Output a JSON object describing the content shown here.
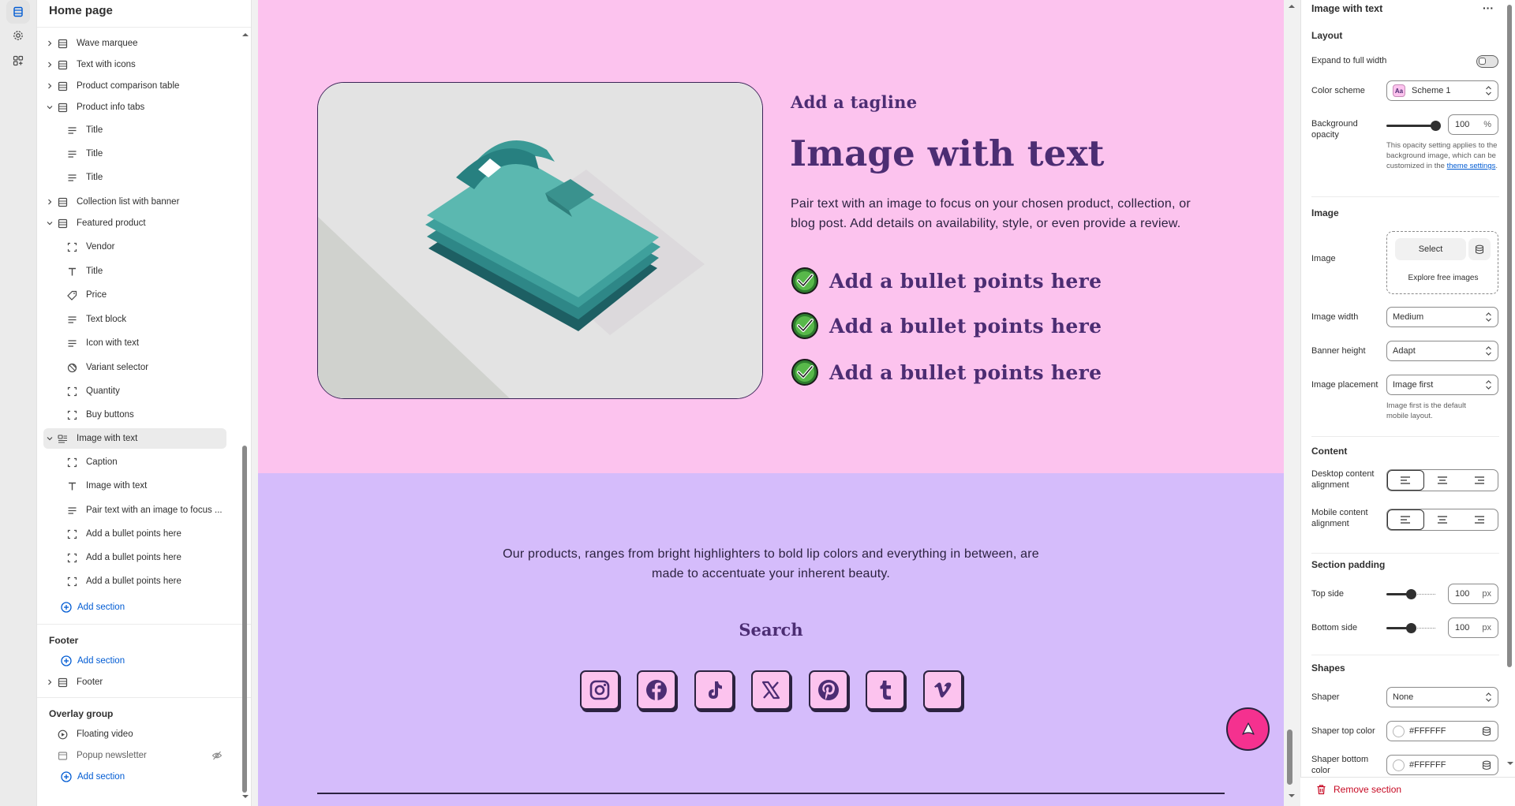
{
  "sidebar": {
    "title": "Home page",
    "items": [
      {
        "label": "Wave marquee",
        "icon": "section-icon",
        "expanded": false
      },
      {
        "label": "Text with icons",
        "icon": "section-icon",
        "expanded": false
      },
      {
        "label": "Product comparison table",
        "icon": "section-icon",
        "expanded": false
      },
      {
        "label": "Product info tabs",
        "icon": "section-icon",
        "expanded": true
      },
      {
        "label": "Title",
        "icon": "text-block-icon"
      },
      {
        "label": "Title",
        "icon": "text-block-icon"
      },
      {
        "label": "Title",
        "icon": "text-block-icon"
      },
      {
        "label": "Collection list with banner",
        "icon": "section-icon",
        "expanded": false
      },
      {
        "label": "Featured product",
        "icon": "section-icon",
        "expanded": true
      },
      {
        "label": "Vendor",
        "icon": "block-icon"
      },
      {
        "label": "Title",
        "icon": "title-icon"
      },
      {
        "label": "Price",
        "icon": "price-icon"
      },
      {
        "label": "Text block",
        "icon": "text-block-icon"
      },
      {
        "label": "Icon with text",
        "icon": "text-block-icon"
      },
      {
        "label": "Variant selector",
        "icon": "variant-icon"
      },
      {
        "label": "Quantity",
        "icon": "block-icon"
      },
      {
        "label": "Buy buttons",
        "icon": "block-icon"
      },
      {
        "label": "Image with text",
        "icon": "image-text-icon",
        "expanded": true,
        "selected": true
      },
      {
        "label": "Caption",
        "icon": "block-icon"
      },
      {
        "label": "Image with text",
        "icon": "title-icon"
      },
      {
        "label": "Pair text with an image to focus ...",
        "icon": "text-block-icon"
      },
      {
        "label": "Add a bullet points here",
        "icon": "block-icon"
      },
      {
        "label": "Add a bullet points here",
        "icon": "block-icon"
      },
      {
        "label": "Add a bullet points here",
        "icon": "block-icon"
      }
    ],
    "add_section": "Add section",
    "footer_group": {
      "title": "Footer",
      "add_section": "Add section",
      "items": [
        {
          "label": "Footer"
        }
      ]
    },
    "overlay_group": {
      "title": "Overlay group",
      "items": [
        {
          "label": "Floating video"
        },
        {
          "label": "Popup newsletter"
        }
      ],
      "add_section": "Add section"
    }
  },
  "preview": {
    "tagline": "Add a tagline",
    "title": "Image with text",
    "body": "Pair text with an image to focus on your chosen product, collection, or blog post. Add details on availability, style, or even provide a review.",
    "bullets": [
      "Add a bullet points here",
      "Add a bullet points here",
      "Add a bullet points here"
    ],
    "lavender_text": "Our products, ranges from bright highlighters to bold lip colors and everything in between, are made to accentuate your inherent beauty.",
    "search_label": "Search",
    "socials": [
      "instagram-icon",
      "facebook-icon",
      "tiktok-icon",
      "x-icon",
      "pinterest-icon",
      "tumblr-icon",
      "vimeo-icon"
    ],
    "colors": {
      "pink": "#fcc3ee",
      "lavender": "#d5bcfb",
      "heading": "#4c2d73",
      "accent": "#f5318f"
    }
  },
  "panel": {
    "title": "Image with text",
    "layout": {
      "heading": "Layout",
      "expand_label": "Expand to full width",
      "expand_on": false,
      "color_scheme_label": "Color scheme",
      "color_scheme_value": "Scheme 1",
      "color_scheme_badge": "Aa",
      "bg_opacity_label": "Background opacity",
      "bg_opacity_value": "100",
      "bg_opacity_unit": "%",
      "bg_opacity_fraction": 1.0,
      "hint_text": "This opacity setting applies to the background image, which can be customized in the ",
      "hint_link": "theme settings",
      "hint_end": "."
    },
    "image": {
      "heading": "Image",
      "image_label": "Image",
      "select_label": "Select",
      "explore_label": "Explore free images",
      "width_label": "Image width",
      "width_value": "Medium",
      "height_label": "Banner height",
      "height_value": "Adapt",
      "placement_label": "Image placement",
      "placement_value": "Image first",
      "placement_hint": "Image first is the default mobile layout."
    },
    "content": {
      "heading": "Content",
      "desktop_label": "Desktop content alignment",
      "mobile_label": "Mobile content alignment"
    },
    "padding": {
      "heading": "Section padding",
      "top_label": "Top side",
      "top_value": "100",
      "bottom_label": "Bottom side",
      "bottom_value": "100",
      "unit": "px",
      "top_fraction": 0.5,
      "bottom_fraction": 0.5
    },
    "shapes": {
      "heading": "Shapes",
      "shaper_label": "Shaper",
      "shaper_value": "None",
      "top_color_label": "Shaper top color",
      "top_color_value": "#FFFFFF",
      "bottom_color_label": "Shaper bottom color",
      "bottom_color_value": "#FFFFFF"
    },
    "remove_label": "Remove section"
  }
}
